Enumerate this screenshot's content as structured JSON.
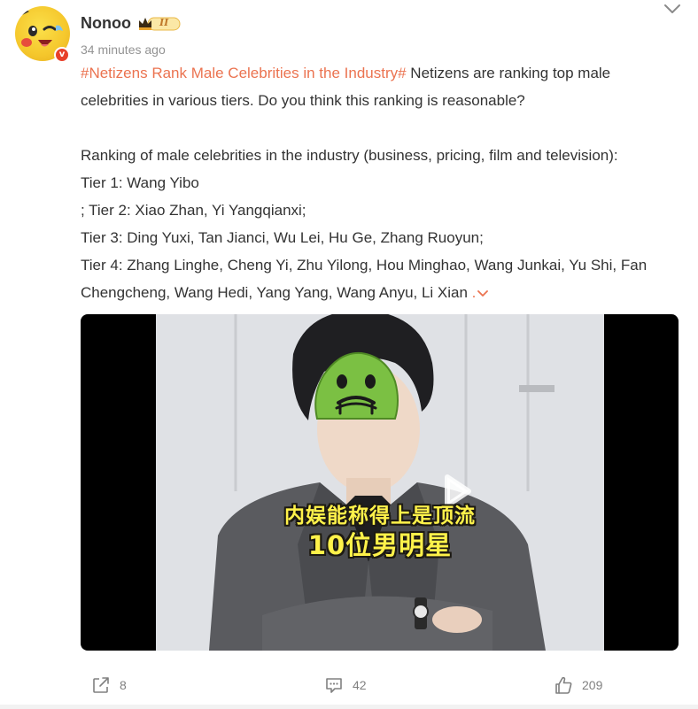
{
  "post": {
    "author": {
      "username": "Nonoo",
      "rank_badge": "II",
      "verified_icon": "verified-v-icon",
      "avatar_icon": "pikachu-avatar-icon"
    },
    "timestamp": "34 minutes ago",
    "hashtag": "#Netizens Rank Male Celebrities in the Industry#",
    "intro_line_1": " Netizens are ranking top male",
    "intro_line_2": "celebrities in various tiers. Do you think this ranking is reasonable?",
    "ranking_heading": "Ranking of male celebrities in the industry (business, pricing, film and television):",
    "tiers": [
      "Tier 1: Wang Yibo",
      "; Tier 2: Xiao Zhan, Yi Yangqianxi;",
      "Tier 3: Ding Yuxi, Tan Jianci, Wu Lei, Hu Ge, Zhang Ruoyun;",
      "Tier 4: Zhang Linghe, Cheng Yi, Zhu Yilong, Hou Minghao, Wang Junkai, Yu Shi, Fan",
      "Chengcheng, Wang Hedi, Yang Yang, Wang Anyu, Li Xian "
    ],
    "expand_label": ".",
    "video": {
      "caption_line_1": "内娱能称得上是顶流",
      "caption_line_2": "10位男明星",
      "play_icon": "play-icon",
      "emoji_icon": "sick-face-emoji-icon"
    },
    "actions": {
      "share_count": "8",
      "comment_count": "42",
      "like_count": "209"
    }
  },
  "colors": {
    "hashtag": "#eb7350",
    "text": "#333333",
    "muted": "#939393",
    "caption": "#fff24a"
  }
}
